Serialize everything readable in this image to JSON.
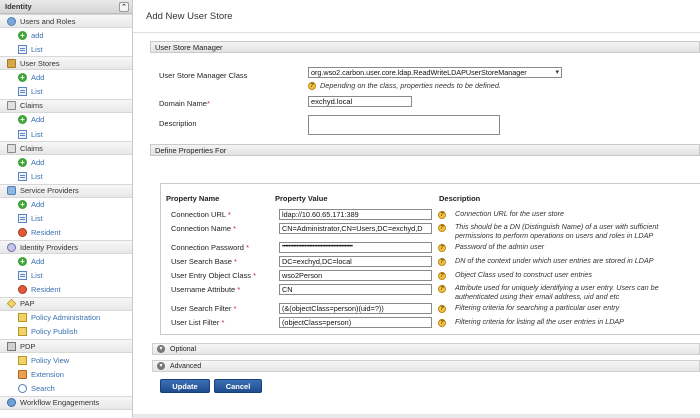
{
  "sidebar": {
    "header": "Identity",
    "sections": [
      {
        "label": "Users and Roles",
        "icon": "users-icon"
      },
      {
        "label": "add",
        "icon": "add-icon"
      },
      {
        "label": "List",
        "icon": "list-icon"
      },
      {
        "label": "User Stores",
        "icon": "user-store-icon"
      },
      {
        "label": "Add",
        "icon": "add-icon"
      },
      {
        "label": "List",
        "icon": "list-icon"
      },
      {
        "label": "Claims",
        "icon": "claims-icon"
      },
      {
        "label": "Add",
        "icon": "add-icon"
      },
      {
        "label": "List",
        "icon": "list-icon"
      },
      {
        "label": "Claims",
        "icon": "claims-icon"
      },
      {
        "label": "Add",
        "icon": "add-icon"
      },
      {
        "label": "List",
        "icon": "list-icon"
      },
      {
        "label": "Service Providers",
        "icon": "service-provider-icon"
      },
      {
        "label": "Add",
        "icon": "add-icon"
      },
      {
        "label": "List",
        "icon": "list-icon"
      },
      {
        "label": "Resident",
        "icon": "resident-icon"
      },
      {
        "label": "Identity Providers",
        "icon": "identity-provider-icon"
      },
      {
        "label": "Add",
        "icon": "add-icon"
      },
      {
        "label": "List",
        "icon": "list-icon"
      },
      {
        "label": "Resident",
        "icon": "resident-icon"
      },
      {
        "label": "PAP",
        "icon": "pap-icon"
      },
      {
        "label": "Policy Administration",
        "icon": "policy-admin-icon"
      },
      {
        "label": "Policy Publish",
        "icon": "policy-publish-icon"
      },
      {
        "label": "PDP",
        "icon": "pdp-icon"
      },
      {
        "label": "Policy View",
        "icon": "policy-view-icon"
      },
      {
        "label": "Extension",
        "icon": "extension-icon"
      },
      {
        "label": "Search",
        "icon": "search-icon"
      },
      {
        "label": "Workflow Engagements",
        "icon": "workflow-icon"
      }
    ]
  },
  "main": {
    "title": "Add New User Store",
    "manager_section": "User Store Manager",
    "class_label": "User Store Manager Class",
    "class_value": "org.wso2.carbon.user.core.ldap.ReadWriteLDAPUserStoreManager",
    "class_note": "Depending on the class, properties needs to be defined.",
    "domain_label": "Domain Name",
    "domain_value": "exchyd.local",
    "description_label": "Description",
    "define_section": "Define Properties For",
    "col_name": "Property Name",
    "col_value": "Property Value",
    "col_desc": "Description",
    "properties": [
      {
        "name": "Connection URL",
        "value": "ldap://10.60.65.171:389",
        "desc": "Connection URL for the user store"
      },
      {
        "name": "Connection Name",
        "value": "CN=Administrator,CN=Users,DC=exchyd,D",
        "desc": "This should be a DN (Distinguish Name) of a user with sufficient permissions to perform operations on users and roles in LDAP"
      },
      {
        "name": "Connection Password",
        "value": "••••••••••••••••••••••••••••••••••••••••••••",
        "desc": "Password of the admin user"
      },
      {
        "name": "User Search Base",
        "value": "DC=exchyd,DC=local",
        "desc": "DN of the context under which user entries are stored in LDAP"
      },
      {
        "name": "User Entry Object Class",
        "value": "wso2Person",
        "desc": "Object Class used to construct user entries"
      },
      {
        "name": "Username Attribute",
        "value": "CN",
        "desc": "Attribute used for uniquely identifying a user entry. Users can be authenticated using their email address, uid and etc"
      },
      {
        "name": "User Search Filter",
        "value": "(&(objectClass=person)(uid=?))",
        "desc": "Filtering criteria for searching a particular user entry"
      },
      {
        "name": "User List Filter",
        "value": "(objectClass=person)",
        "desc": "Filtering criteria for listing all the user entries in LDAP"
      }
    ],
    "optional_label": "Optional",
    "advanced_label": "Advanced",
    "update_button": "Update",
    "cancel_button": "Cancel",
    "required_mark": "*",
    "help_glyph": "?",
    "collapse_glyph": "⌃",
    "select_caret": "▾"
  },
  "colors": {
    "link": "#3a6fb0",
    "button": "#1f4d8e",
    "required": "#cc2222",
    "help": "#f3c24a"
  }
}
